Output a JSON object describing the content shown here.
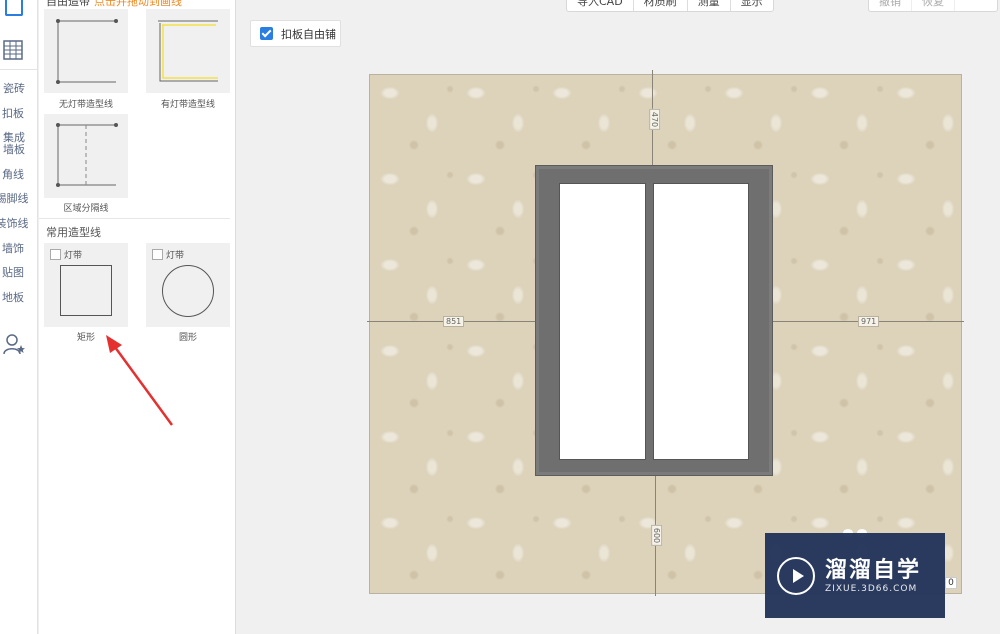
{
  "sidebar": {
    "items": [
      {
        "label": "瓷砖"
      },
      {
        "label": "扣板"
      },
      {
        "label": "集成\n墙板"
      },
      {
        "label": "角线"
      },
      {
        "label": "踢脚线"
      },
      {
        "label": "装饰线"
      },
      {
        "label": "墙饰"
      },
      {
        "label": "贴图"
      },
      {
        "label": "地板"
      }
    ]
  },
  "panel": {
    "header": "自由造带",
    "header_hint": "点击并拖动到画线",
    "cards": [
      {
        "label": "无灯带造型线"
      },
      {
        "label": "有灯带造型线"
      },
      {
        "label": "区域分隔线"
      }
    ],
    "section_title": "常用造型线",
    "shapes": [
      {
        "label": "矩形",
        "check_label": "灯带"
      },
      {
        "label": "圆形",
        "check_label": "灯带"
      }
    ]
  },
  "toolbar": {
    "buttons": [
      {
        "label": "导入CAD"
      },
      {
        "label": "材质刷"
      },
      {
        "label": "测量"
      },
      {
        "label": "显示"
      }
    ],
    "right_buttons": [
      {
        "label": "撤销"
      },
      {
        "label": "恢复"
      }
    ]
  },
  "free_tile": {
    "label": "扣板自由铺",
    "checked": true
  },
  "canvas": {
    "dimensions": {
      "top": "470",
      "left": "851",
      "right": "971",
      "bottom": "600"
    }
  },
  "watermark": {
    "title": "溜溜自学",
    "subtitle": "ZIXUE.3D66.COM"
  },
  "corner_value": "0",
  "colors": {
    "accent": "#2a7de1",
    "hint": "#f08a24",
    "annotation": "#e53030",
    "watermark_bg": "#25365c"
  }
}
